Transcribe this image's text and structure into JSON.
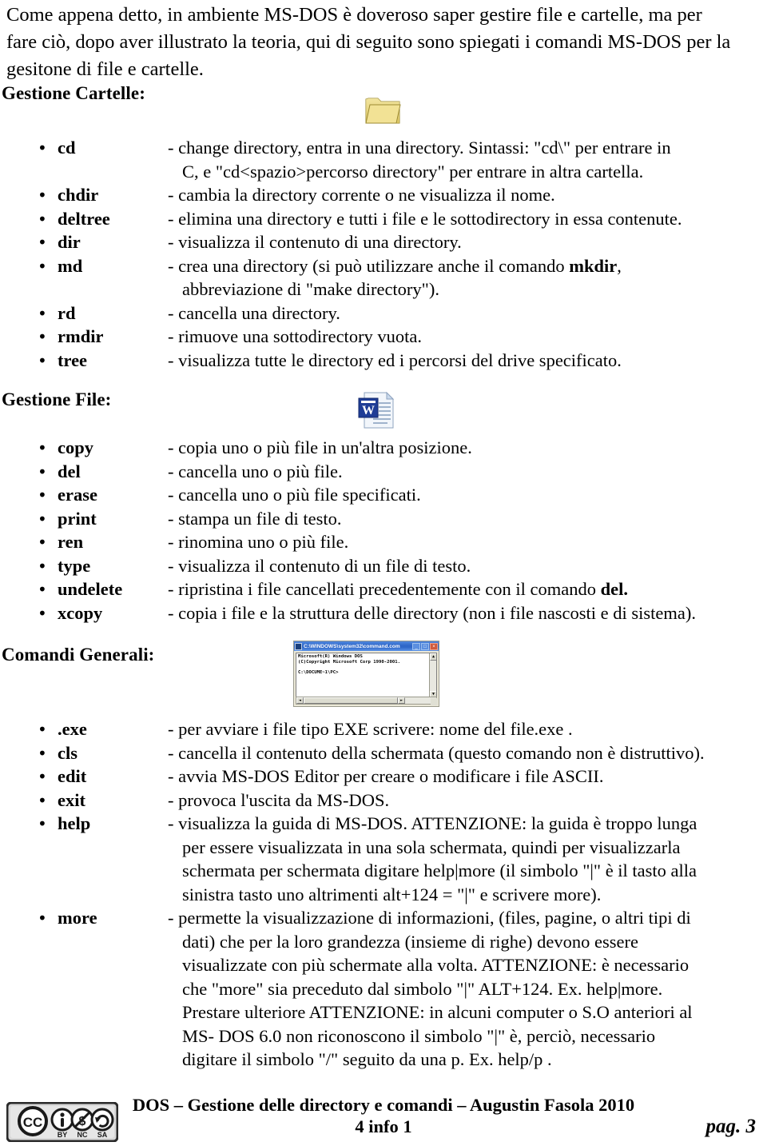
{
  "document": {
    "intro_lines": [
      "Come appena detto, in ambiente MS-DOS è doveroso saper gestire file e cartelle, ma per",
      "fare ciò, dopo aver illustrato la teoria, qui di seguito sono spiegati i comandi MS-DOS per la",
      "gesitone di file e cartelle."
    ],
    "sections": [
      {
        "id": "cartelle",
        "heading": "Gestione Cartelle:",
        "icon": "folder-icon",
        "commands": [
          {
            "bullet": "•",
            "name": "cd",
            "lines": [
              {
                "text": "- change directory, entra in una directory. Sintassi: \"cd\\\" per entrare in",
                "indent": false
              },
              {
                "text": "C, e \"cd<spazio>percorso directory\" per entrare in altra cartella.",
                "indent": true
              }
            ]
          },
          {
            "bullet": "•",
            "name": "chdir",
            "lines": [
              {
                "text": "- cambia la directory corrente o ne visualizza il nome.",
                "indent": false
              }
            ]
          },
          {
            "bullet": "•",
            "name": "deltree",
            "lines": [
              {
                "text": "- elimina una directory e tutti i file e le sottodirectory in essa contenute.",
                "indent": false
              }
            ]
          },
          {
            "bullet": "•",
            "name": "dir",
            "lines": [
              {
                "text": "- visualizza il contenuto di una directory.",
                "indent": false
              }
            ]
          },
          {
            "bullet": "•",
            "name": "md",
            "lines": [
              {
                "html": "- crea una directory (si può utilizzare anche il comando <b>mkdir</b>,",
                "indent": false
              },
              {
                "text": "abbreviazione di \"make directory\").",
                "indent": true
              }
            ]
          },
          {
            "bullet": "•",
            "name": "rd",
            "lines": [
              {
                "text": "- cancella una directory.",
                "indent": false
              }
            ]
          },
          {
            "bullet": "•",
            "name": "rmdir",
            "lines": [
              {
                "text": "- rimuove una sottodirectory vuota.",
                "indent": false
              }
            ]
          },
          {
            "bullet": "•",
            "name": "tree",
            "lines": [
              {
                "text": "- visualizza tutte le directory ed i percorsi del drive specificato.",
                "indent": false
              }
            ]
          }
        ]
      },
      {
        "id": "file",
        "heading": "Gestione File:",
        "icon": "word-document-icon",
        "commands": [
          {
            "bullet": "•",
            "name": "copy",
            "lines": [
              {
                "text": "- copia uno o più file in un'altra posizione.",
                "indent": false
              }
            ]
          },
          {
            "bullet": "•",
            "name": "del",
            "lines": [
              {
                "text": "- cancella uno o più file.",
                "indent": false
              }
            ]
          },
          {
            "bullet": "•",
            "name": "erase",
            "lines": [
              {
                "text": "- cancella uno o più file specificati.",
                "indent": false
              }
            ]
          },
          {
            "bullet": "•",
            "name": "print",
            "lines": [
              {
                "text": "- stampa un file di testo.",
                "indent": false
              }
            ]
          },
          {
            "bullet": "•",
            "name": "ren",
            "lines": [
              {
                "text": "- rinomina uno o più file.",
                "indent": false
              }
            ]
          },
          {
            "bullet": "•",
            "name": "type",
            "lines": [
              {
                "text": "- visualizza il contenuto di un file di testo.",
                "indent": false
              }
            ]
          },
          {
            "bullet": "•",
            "name": "undelete",
            "lines": [
              {
                "html": "- ripristina i file cancellati precedentemente con il comando <b>del.</b>",
                "indent": false
              }
            ]
          },
          {
            "bullet": "•",
            "name": "xcopy",
            "lines": [
              {
                "text": "- copia i file e la struttura delle directory (non i file nascosti e di sistema).",
                "indent": false
              }
            ]
          }
        ]
      },
      {
        "id": "generali",
        "heading": "Comandi Generali:",
        "icon": "dos-window-screenshot",
        "commands": [
          {
            "bullet": "•",
            "name": ".exe",
            "lines": [
              {
                "text": "- per avviare i file tipo EXE scrivere: nome del file.exe .",
                "indent": false
              }
            ]
          },
          {
            "bullet": "•",
            "name": "cls",
            "lines": [
              {
                "text": "- cancella il contenuto della schermata (questo comando non è distruttivo).",
                "indent": false
              }
            ]
          },
          {
            "bullet": "•",
            "name": "edit",
            "lines": [
              {
                "text": "- avvia MS-DOS Editor per creare o modificare i file ASCII.",
                "indent": false
              }
            ]
          },
          {
            "bullet": "•",
            "name": "exit",
            "lines": [
              {
                "text": "- provoca l'uscita da MS-DOS.",
                "indent": false
              }
            ]
          },
          {
            "bullet": "•",
            "name": "help",
            "lines": [
              {
                "text": "- visualizza la guida di MS-DOS. ATTENZIONE: la guida è troppo lunga",
                "indent": false
              },
              {
                "text": "per essere visualizzata in una sola schermata, quindi per visualizzarla",
                "indent": true
              },
              {
                "text": "schermata per schermata digitare help|more (il simbolo \"|\" è il tasto alla",
                "indent": true
              },
              {
                "text": "sinistra tasto uno altrimenti alt+124 = \"|\" e scrivere  more).",
                "indent": true
              }
            ]
          },
          {
            "bullet": "•",
            "name": "more",
            "lines": [
              {
                "text": "- permette la visualizzazione di informazioni, (files, pagine, o altri tipi di",
                "indent": false
              },
              {
                "text": "dati) che per la loro grandezza (insieme di righe) devono essere",
                "indent": true
              },
              {
                "text": "visualizzate con più schermate alla volta. ATTENZIONE: è necessario",
                "indent": true
              },
              {
                "text": "che \"more\" sia preceduto dal simbolo \"|\" ALT+124. Ex. help|more.",
                "indent": true
              },
              {
                "text": "Prestare ulteriore ATTENZIONE: in alcuni computer o S.O anteriori al",
                "indent": true
              },
              {
                "text": "MS- DOS 6.0 non riconoscono il simbolo \"|\" è, perciò, necessario",
                "indent": true
              },
              {
                "text": "digitare il simbolo \"/\" seguito da una p. Ex. help/p .",
                "indent": true
              }
            ]
          }
        ]
      }
    ],
    "dos_window": {
      "title": "C:\\WINDOWS\\system32\\command.com",
      "minimize_label": "_",
      "maximize_label": "□",
      "close_label": "×",
      "console_text": "Microsoft(R) Windows DOS\n(C)Copyright Microsoft Corp 1990-2001.\n\nC:\\DOCUME~1\\PC>"
    },
    "footer": {
      "line1": "DOS – Gestione delle directory e comandi – Augustin Fasola 2010",
      "line2": "4 info 1",
      "page": "pag. 3",
      "license": {
        "name": "cc",
        "terms": [
          "BY",
          "NC",
          "SA"
        ]
      }
    },
    "colors": {
      "text": "#000000",
      "background": "#ffffff",
      "folder": "#e8d47a",
      "word_blue": "#1a3a8f",
      "titlebar_blue": "#2f67c8"
    }
  }
}
